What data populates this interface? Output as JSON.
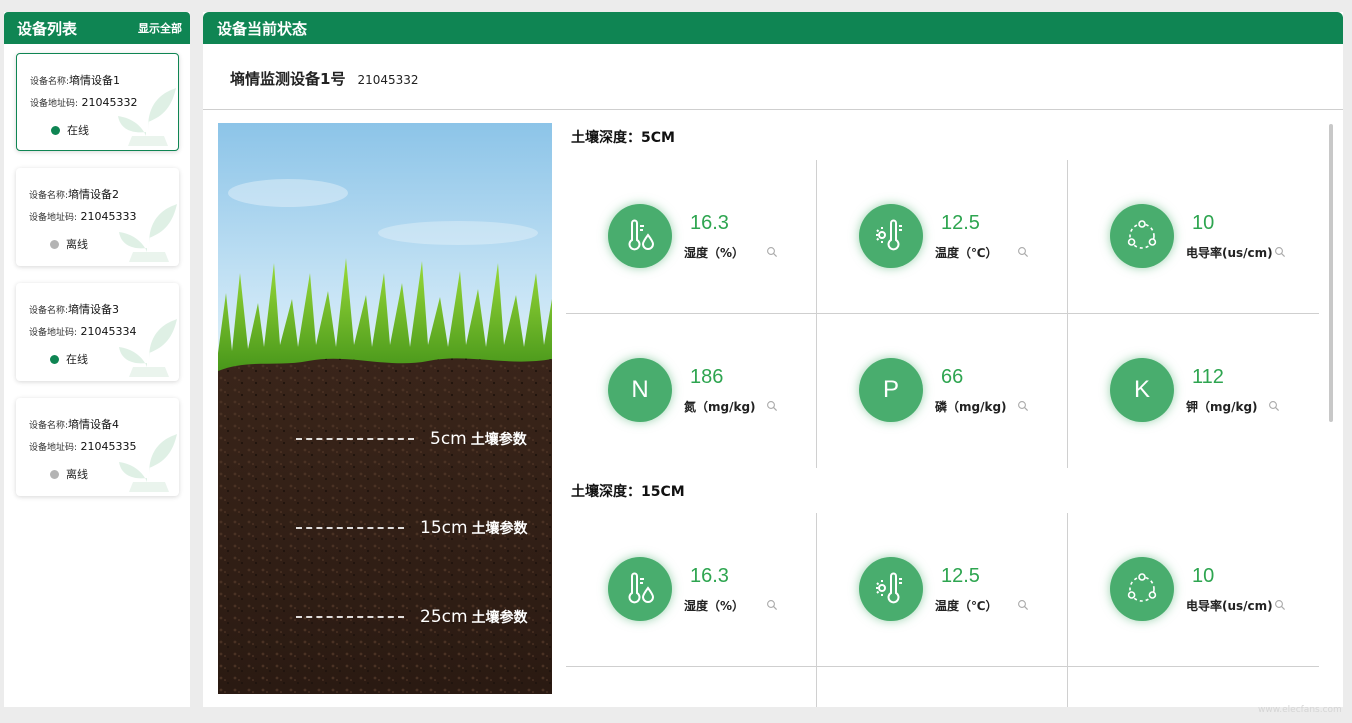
{
  "sidebar": {
    "title": "设备列表",
    "show_all": "显示全部",
    "devices": [
      {
        "name_label": "设备名称:",
        "name": "墒情设备1",
        "addr_label": "设备地址码:",
        "addr": "21045332",
        "status": "在线",
        "online": true
      },
      {
        "name_label": "设备名称:",
        "name": "墒情设备2",
        "addr_label": "设备地址码:",
        "addr": "21045333",
        "status": "离线",
        "online": false
      },
      {
        "name_label": "设备名称:",
        "name": "墒情设备3",
        "addr_label": "设备地址码:",
        "addr": "21045334",
        "status": "在线",
        "online": true
      },
      {
        "name_label": "设备名称:",
        "name": "墒情设备4",
        "addr_label": "设备地址码:",
        "addr": "21045335",
        "status": "离线",
        "online": false
      }
    ]
  },
  "main": {
    "title": "设备当前状态",
    "device_name": "墒情监测设备1号",
    "device_addr": "21045332"
  },
  "soil_image": {
    "layers": [
      {
        "depth": "5cm",
        "text": "土壤参数"
      },
      {
        "depth": "15cm",
        "text": "土壤参数"
      },
      {
        "depth": "25cm",
        "text": "土壤参数"
      }
    ]
  },
  "sections": [
    {
      "title": "土壤深度：5CM",
      "metrics": [
        {
          "icon": "humidity-icon",
          "value": "16.3",
          "label": "湿度（%）"
        },
        {
          "icon": "temperature-icon",
          "value": "12.5",
          "label": "温度（℃）"
        },
        {
          "icon": "conductivity-icon",
          "value": "10",
          "label": "电导率(us/cm)"
        },
        {
          "icon": "nitrogen-icon",
          "letter": "N",
          "value": "186",
          "label": "氮（mg/kg)"
        },
        {
          "icon": "phosphorus-icon",
          "letter": "P",
          "value": "66",
          "label": "磷（mg/kg)"
        },
        {
          "icon": "potassium-icon",
          "letter": "K",
          "value": "112",
          "label": "钾（mg/kg)"
        }
      ]
    },
    {
      "title": "土壤深度：15CM",
      "metrics": [
        {
          "icon": "humidity-icon",
          "value": "16.3",
          "label": "湿度（%）"
        },
        {
          "icon": "temperature-icon",
          "value": "12.5",
          "label": "温度（℃）"
        },
        {
          "icon": "conductivity-icon",
          "value": "10",
          "label": "电导率(us/cm)"
        }
      ]
    }
  ],
  "colors": {
    "brand": "#0f8553",
    "metric_circle": "#49ad6e",
    "value_text": "#2ea550",
    "online": "#0f8553",
    "offline": "#b4b4b4"
  },
  "watermark": "www.elecfans.com"
}
